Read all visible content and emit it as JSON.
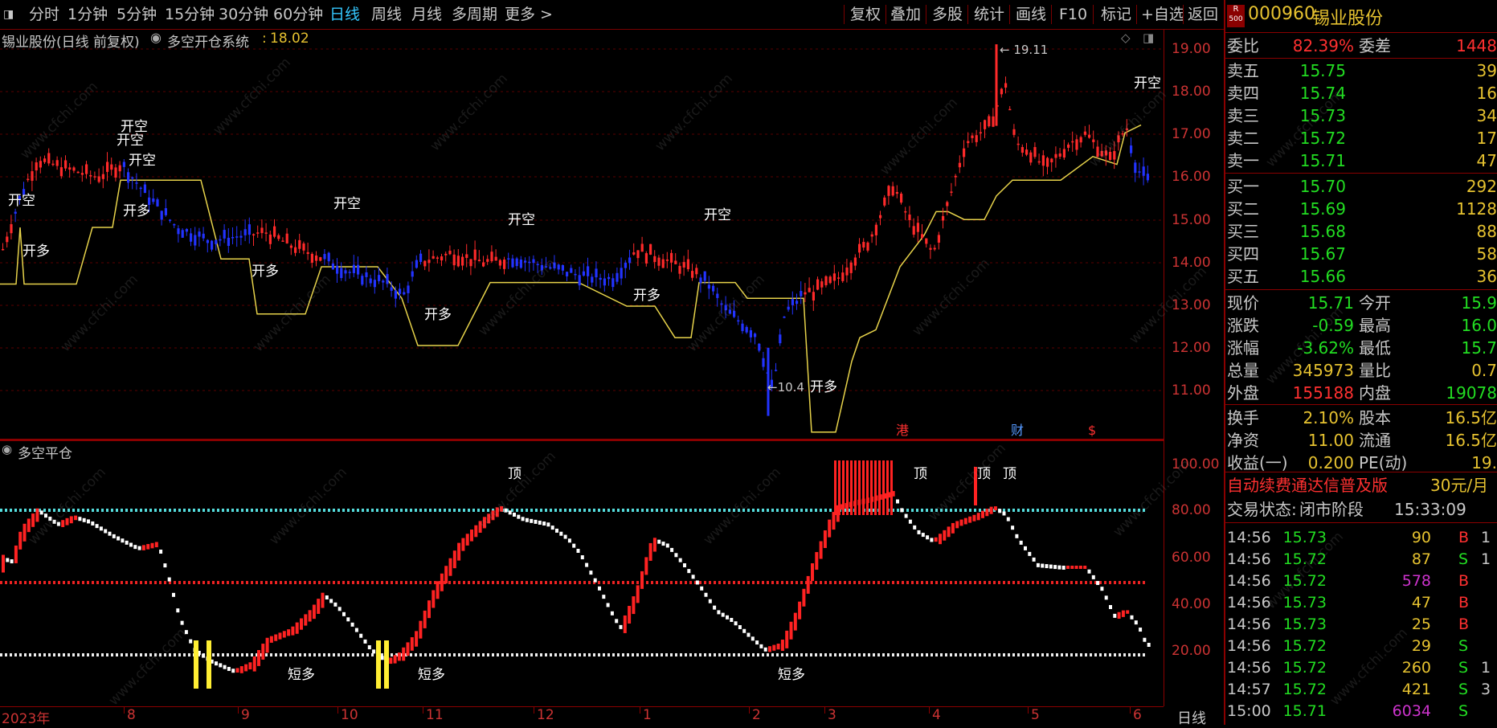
{
  "toolbar": {
    "left_tabs": [
      "分时",
      "1分钟",
      "5分钟",
      "15分钟",
      "30分钟",
      "60分钟",
      "日线",
      "周线",
      "月线",
      "多周期",
      "更多 >"
    ],
    "active_tab": "日线",
    "right_buttons": [
      "复权",
      "叠加",
      "多股",
      "统计",
      "画线",
      "F10",
      "标记",
      "+自选",
      "返回"
    ]
  },
  "main_chart": {
    "stock_label": "锡业股份(日线 前复权)",
    "indicator_name": "多空开仓系统",
    "indicator_value": "18.02",
    "y_ticks": [
      "19.00",
      "18.00",
      "17.00",
      "16.00",
      "15.00",
      "14.00",
      "13.00",
      "12.00",
      "11.00"
    ],
    "high_annotation": "19.11",
    "low_annotation": "10.4",
    "signals_kai_kong": "开空",
    "signals_kai_duo": "开多",
    "markers": [
      "港",
      "财",
      "$"
    ]
  },
  "sub_chart": {
    "name": "多空平仓",
    "y_ticks": [
      "100.00",
      "80.00",
      "60.00",
      "40.00",
      "20.00"
    ],
    "label_top": "顶",
    "label_short": "短多"
  },
  "x_axis": {
    "labels": [
      "2023年",
      "8",
      "9",
      "10",
      "11",
      "12",
      "1",
      "2",
      "3",
      "4",
      "5",
      "6"
    ],
    "period": "日线"
  },
  "quote_panel": {
    "code": "000960",
    "name": "锡业股份",
    "badge_top": "R",
    "badge_bottom": "500",
    "weibi_label": "委比",
    "weibi_value": "82.39%",
    "weicha_label": "委差",
    "weicha_value": "1448",
    "asks": [
      {
        "label": "卖五",
        "price": "15.75",
        "vol": "39"
      },
      {
        "label": "卖四",
        "price": "15.74",
        "vol": "16"
      },
      {
        "label": "卖三",
        "price": "15.73",
        "vol": "34"
      },
      {
        "label": "卖二",
        "price": "15.72",
        "vol": "17"
      },
      {
        "label": "卖一",
        "price": "15.71",
        "vol": "47"
      }
    ],
    "bids": [
      {
        "label": "买一",
        "price": "15.70",
        "vol": "292"
      },
      {
        "label": "买二",
        "price": "15.69",
        "vol": "1128"
      },
      {
        "label": "买三",
        "price": "15.68",
        "vol": "88"
      },
      {
        "label": "买四",
        "price": "15.67",
        "vol": "58"
      },
      {
        "label": "买五",
        "price": "15.66",
        "vol": "36"
      }
    ],
    "stats": [
      {
        "l1": "现价",
        "v1": "15.71",
        "c1": "#22dd22",
        "l2": "今开",
        "v2": "15.9",
        "c2": "#22dd22"
      },
      {
        "l1": "涨跌",
        "v1": "-0.59",
        "c1": "#22dd22",
        "l2": "最高",
        "v2": "16.0",
        "c2": "#22dd22"
      },
      {
        "l1": "涨幅",
        "v1": "-3.62%",
        "c1": "#22dd22",
        "l2": "最低",
        "v2": "15.7",
        "c2": "#22dd22"
      },
      {
        "l1": "总量",
        "v1": "345973",
        "c1": "#e6c230",
        "l2": "量比",
        "v2": "0.7",
        "c2": "#e6c230"
      },
      {
        "l1": "外盘",
        "v1": "155188",
        "c1": "#ff3030",
        "l2": "内盘",
        "v2": "19078",
        "c2": "#22dd22"
      }
    ],
    "stats2": [
      {
        "l1": "换手",
        "v1": "2.10%",
        "l2": "股本",
        "v2": "16.5亿"
      },
      {
        "l1": "净资",
        "v1": "11.00",
        "l2": "流通",
        "v2": "16.5亿"
      },
      {
        "l1": "收益(一)",
        "v1": "0.200",
        "l2": "PE(动)",
        "v2": "19."
      }
    ],
    "promo_text": "自动续费通达信普及版",
    "promo_price": "30元/月",
    "trade_status_label": "交易状态:",
    "trade_status_value": "闭市阶段",
    "trade_time": "15:33:09",
    "ticks": [
      {
        "time": "14:56",
        "price": "15.73",
        "vol": "90",
        "side": "B",
        "n": "1"
      },
      {
        "time": "14:56",
        "price": "15.72",
        "vol": "87",
        "side": "S",
        "n": "1"
      },
      {
        "time": "14:56",
        "price": "15.72",
        "vol": "578",
        "side": "B",
        "n": ""
      },
      {
        "time": "14:56",
        "price": "15.73",
        "vol": "47",
        "side": "B",
        "n": ""
      },
      {
        "time": "14:56",
        "price": "15.73",
        "vol": "25",
        "side": "B",
        "n": ""
      },
      {
        "time": "14:56",
        "price": "15.72",
        "vol": "29",
        "side": "S",
        "n": ""
      },
      {
        "time": "14:56",
        "price": "15.72",
        "vol": "260",
        "side": "S",
        "n": "1"
      },
      {
        "time": "14:57",
        "price": "15.72",
        "vol": "421",
        "side": "S",
        "n": "3"
      },
      {
        "time": "15:00",
        "price": "15.71",
        "vol": "6034",
        "side": "S",
        "n": ""
      }
    ],
    "tick_vol_colors": [
      "#e6c230",
      "#e6c230",
      "#cc33cc",
      "#e6c230",
      "#e6c230",
      "#e6c230",
      "#e6c230",
      "#e6c230",
      "#cc33cc"
    ]
  },
  "watermark": "www.cfchi.com"
}
